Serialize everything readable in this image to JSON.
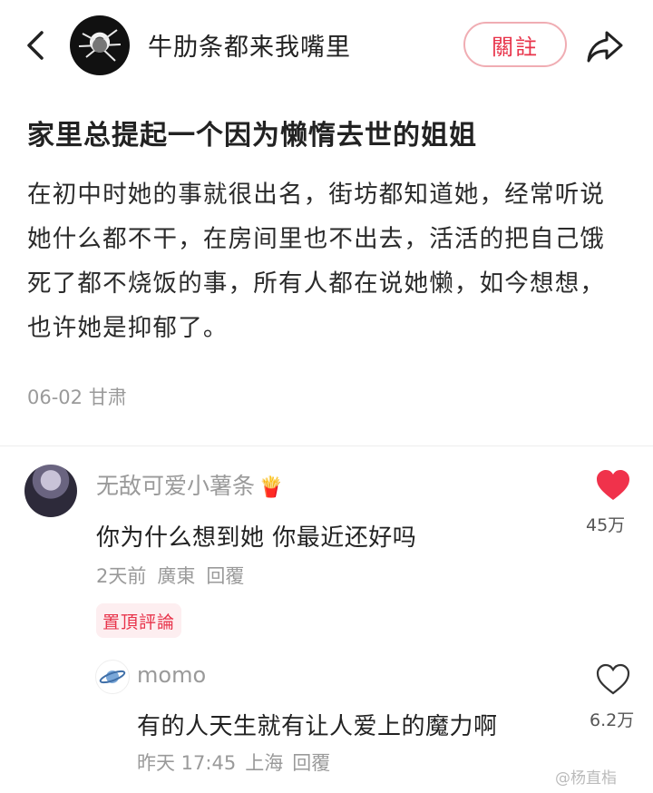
{
  "header": {
    "author_name": "牛肋条都来我嘴里",
    "follow_label": "關註"
  },
  "post": {
    "title": "家里总提起一个因为懒惰去世的姐姐",
    "body_lines": [
      "在初中时她的事就很出名，街坊都知道她，经常听说",
      "她什么都不干，在房间里也不出去，活活的把自己饿",
      "死了都不烧饭的事，所有人都在说她懒，如今想想，",
      "也许她是抑郁了。"
    ],
    "meta": "06-02 甘肃"
  },
  "comments": [
    {
      "author": "无敌可爱小薯条",
      "text": "你为什么想到她 你最近还好吗",
      "time": "2天前",
      "location": "廣東",
      "reply_label": "回覆",
      "pinned_label": "置頂評論",
      "likes": "45万",
      "liked": true
    }
  ],
  "reply": {
    "author": "momo",
    "text": "有的人天生就有让人爱上的魔力啊",
    "time": "昨天 17:45",
    "location": "上海",
    "reply_label": "回覆",
    "likes": "6.2万",
    "liked": false
  },
  "watermark": "@杨直栺",
  "colors": {
    "accent": "#e8334a",
    "muted": "#9a9a9a"
  },
  "icons": [
    "back-arrow-icon",
    "share-icon",
    "heart-filled-icon",
    "heart-outline-icon",
    "fries-emoji-icon",
    "saturn-avatar-icon"
  ]
}
